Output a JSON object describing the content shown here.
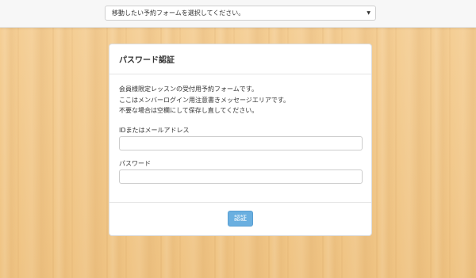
{
  "topbar": {
    "form_select": {
      "selected": "移動したい予約フォームを選択してください。",
      "arrow": "▼"
    }
  },
  "panel": {
    "title": "パスワード認証",
    "message_lines": [
      "会員様限定レッスンの受付用予約フォームです。",
      "ここはメンバーログイン用注意書きメッセージエリアです。",
      "不要な場合は空欄にして保存し直してください。"
    ],
    "id_label": "IDまたはメールアドレス",
    "id_value": "",
    "password_label": "パスワード",
    "password_value": "",
    "submit_label": "認証"
  },
  "colors": {
    "button": "#6aafe0",
    "background": "#f2c98c"
  }
}
